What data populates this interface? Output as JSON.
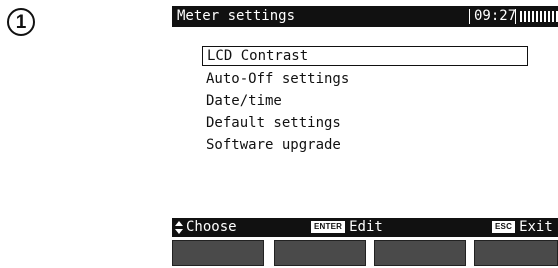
{
  "step": {
    "number": "1"
  },
  "header": {
    "title": "Meter settings",
    "time": "09:27",
    "battery_icon": "battery-full-icon"
  },
  "menu": {
    "items": [
      {
        "label": "LCD Contrast",
        "selected": true
      },
      {
        "label": "Auto-Off settings",
        "selected": false
      },
      {
        "label": "Date/time",
        "selected": false
      },
      {
        "label": "Default settings",
        "selected": false
      },
      {
        "label": "Software upgrade",
        "selected": false
      }
    ]
  },
  "footer": {
    "choose_icon": "up-down-arrows-icon",
    "choose_label": "Choose",
    "enter_key": "ENTER",
    "edit_label": "Edit",
    "esc_key": "ESC",
    "exit_label": "Exit"
  },
  "softkeys": {
    "count": 4
  },
  "colors": {
    "bar_background": "#111111",
    "bar_text": "#ffffff",
    "softkey": "#4a4a4a",
    "screen": "#ffffff"
  }
}
